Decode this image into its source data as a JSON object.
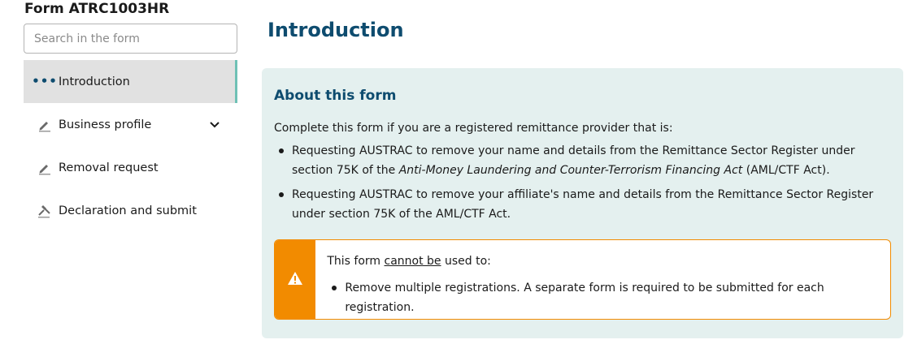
{
  "form": {
    "title": "Form ATRC1003HR"
  },
  "search": {
    "placeholder": "Search in the form"
  },
  "sidebar": {
    "items": [
      {
        "label": "Introduction",
        "icon": "ellipsis-icon",
        "active": true
      },
      {
        "label": "Business profile",
        "icon": "pencil-icon",
        "expandable": true
      },
      {
        "label": "Removal request",
        "icon": "pencil-icon"
      },
      {
        "label": "Declaration and submit",
        "icon": "gavel-icon"
      }
    ]
  },
  "main": {
    "title": "Introduction",
    "panel": {
      "heading": "About this form",
      "intro": "Complete this form if you are a registered remittance provider that is:",
      "bullet1_part1": "Requesting AUSTRAC to remove your name and details from the Remittance Sector Register under section 75K of the ",
      "bullet1_italic": "Anti-Money Laundering and Counter-Terrorism Financing Act",
      "bullet1_part2": " (AML/CTF Act).",
      "bullet2": "Requesting AUSTRAC to remove your affiliate's name and details from the Remittance Sector Register under section 75K of the AML/CTF Act.",
      "warning": {
        "lead_before": "This form ",
        "lead_underlined": "cannot be",
        "lead_after": " used to:",
        "item": "Remove multiple registrations. A separate form is required to be submitted for each registration.",
        "icon": "warning-icon"
      }
    }
  },
  "colors": {
    "accent": "#0e4c6f",
    "panel_bg": "#e4f0ef",
    "warning": "#f28b00",
    "active_bar": "#6fc1b5"
  }
}
